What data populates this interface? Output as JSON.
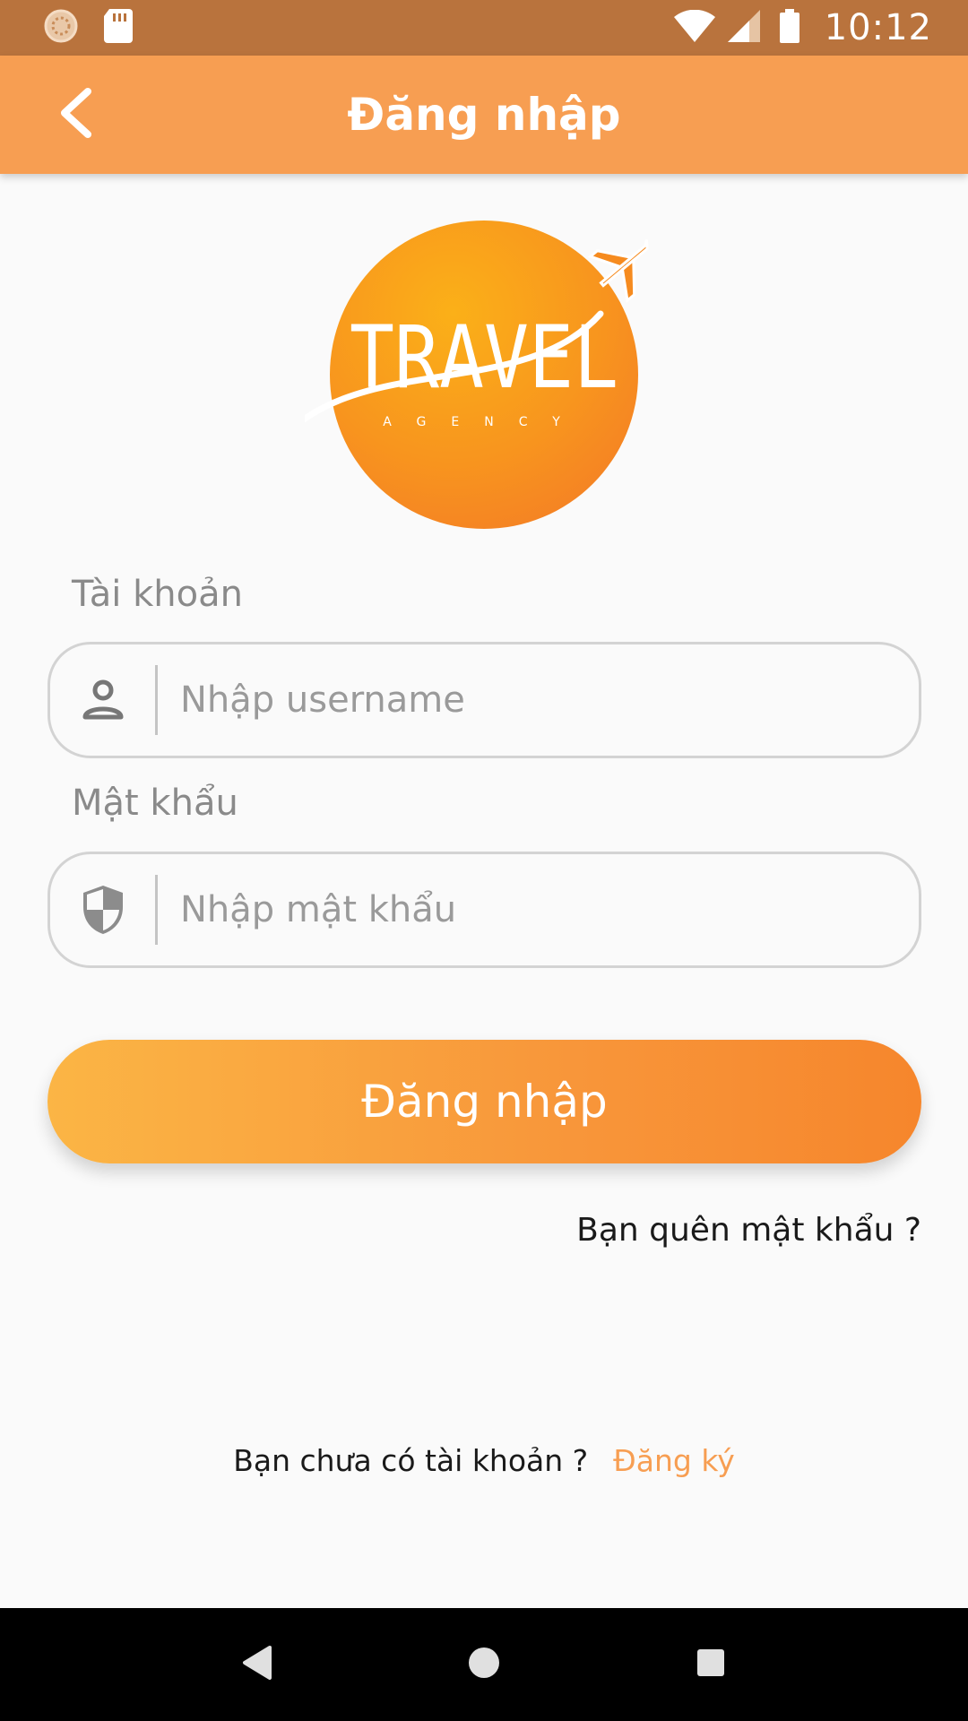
{
  "status_bar": {
    "time": "10:12",
    "icons": [
      "sync-icon",
      "sd-card-icon",
      "wifi-icon",
      "signal-icon",
      "battery-icon"
    ]
  },
  "app_bar": {
    "title": "Đăng nhập",
    "back_icon": "chevron-left-icon"
  },
  "logo": {
    "title": "TRAVEL",
    "subtitle": "AGENCY"
  },
  "form": {
    "username": {
      "label": "Tài khoản",
      "placeholder": "Nhập username",
      "value": "",
      "icon": "person-icon"
    },
    "password": {
      "label": "Mật khẩu",
      "placeholder": "Nhập mật khẩu",
      "value": "",
      "icon": "shield-icon"
    },
    "submit_label": "Đăng nhập",
    "forgot_label": "Bạn quên mật khẩu ?"
  },
  "signup": {
    "question": "Bạn chưa có tài khoản ?",
    "link_label": "Đăng ký"
  },
  "colors": {
    "status_bar": "#b9733d",
    "app_bar": "#f79e52",
    "button_start": "#fbb545",
    "button_end": "#f6862c",
    "accent_link": "#f79e52"
  },
  "nav_bar": {
    "buttons": [
      "back-triangle-icon",
      "home-circle-icon",
      "recents-square-icon"
    ]
  }
}
